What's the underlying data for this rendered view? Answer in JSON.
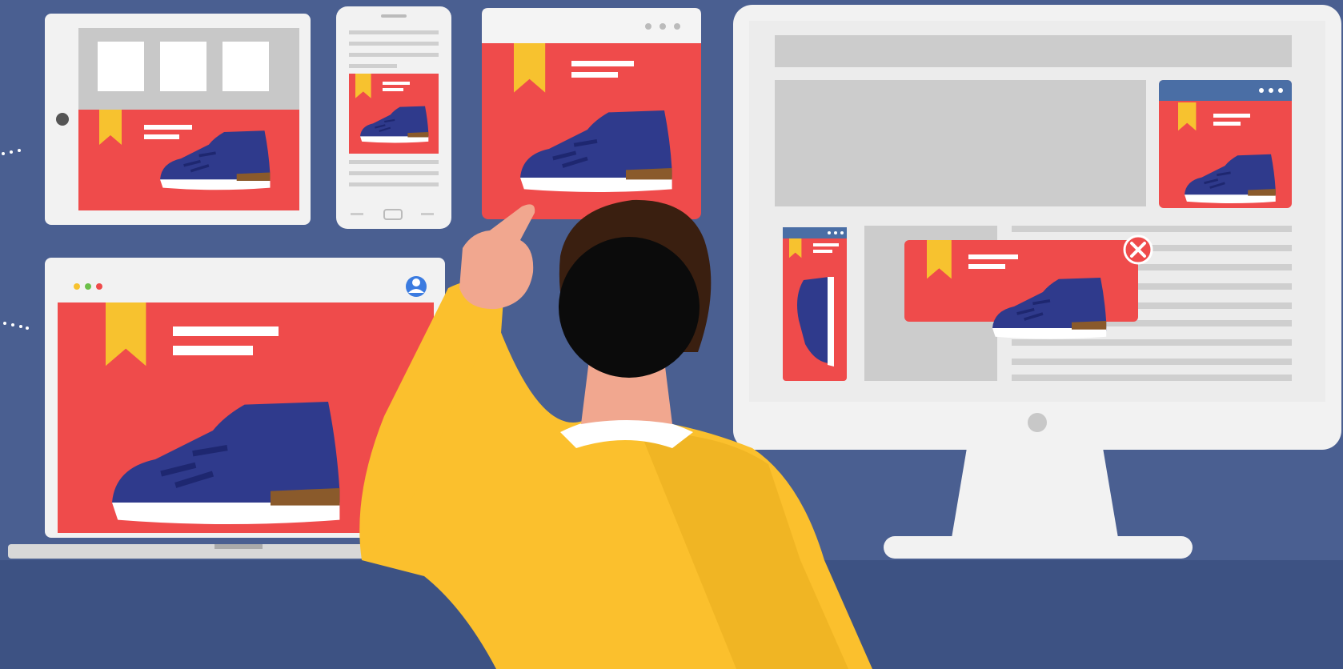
{
  "scene": {
    "background_color": "#4a5f91",
    "floor_color": "#3d5283",
    "ad_color": "#ef4b4b",
    "bookmark_color": "#f7c22f",
    "shoe_color": "#2f3a8c",
    "person_shirt_color": "#fbc02d"
  },
  "devices": [
    {
      "name": "tablet",
      "icon": "tablet-icon"
    },
    {
      "name": "smartphone",
      "icon": "smartphone-icon"
    },
    {
      "name": "browser-window",
      "icon": "browser-icon"
    },
    {
      "name": "laptop",
      "icon": "laptop-icon"
    },
    {
      "name": "desktop-monitor",
      "icon": "monitor-icon"
    }
  ],
  "popup": {
    "close_icon": "close-icon"
  }
}
